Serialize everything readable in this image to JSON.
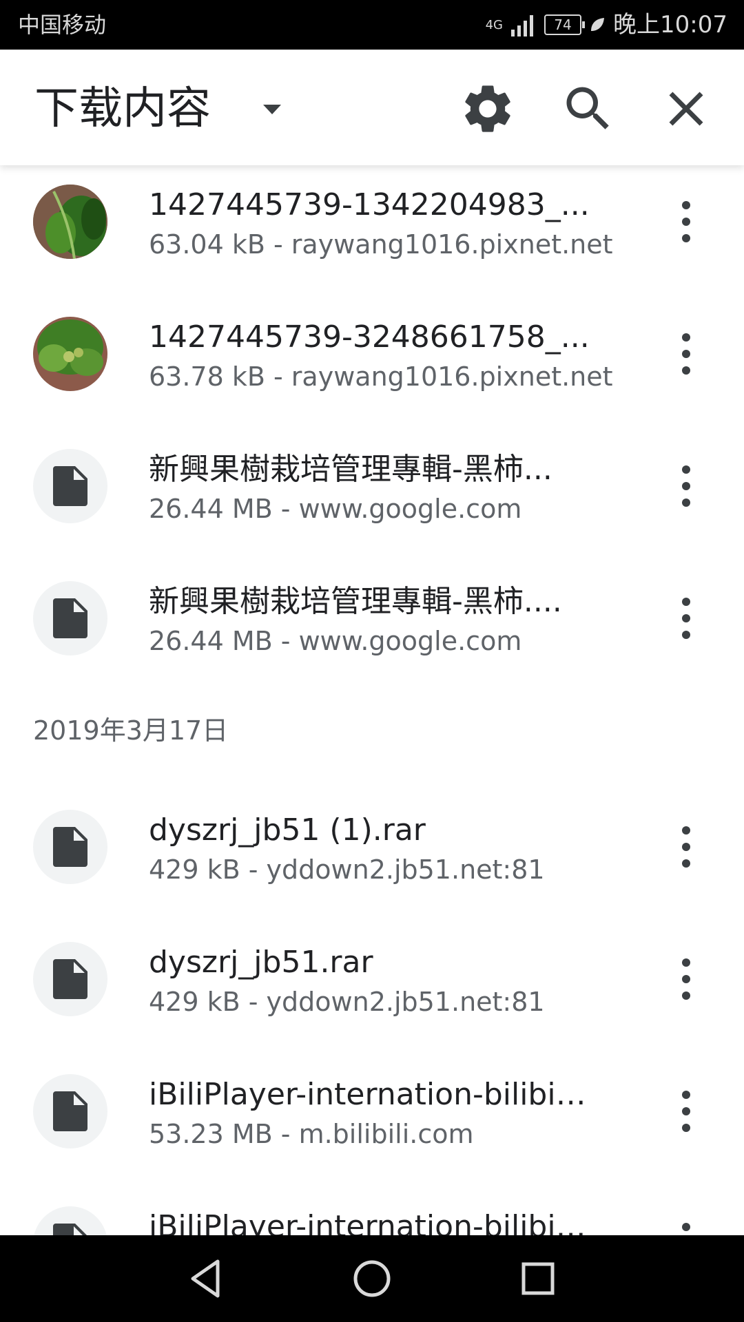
{
  "status_bar": {
    "carrier": "中国移动",
    "network": "4G",
    "battery": "74",
    "time": "晚上10:07"
  },
  "app_bar": {
    "title": "下载内容",
    "icons": [
      "chevron-down-icon",
      "gear-icon",
      "search-icon",
      "close-icon"
    ]
  },
  "downloads": [
    {
      "name": "1427445739-1342204983_...",
      "meta": "63.04 kB - raywang1016.pixnet.net",
      "thumb": "image"
    },
    {
      "name": "1427445739-3248661758_...",
      "meta": "63.78 kB - raywang1016.pixnet.net",
      "thumb": "image"
    },
    {
      "name": "新興果樹栽培管理專輯-黑柿...",
      "meta": "26.44 MB - www.google.com",
      "thumb": "file"
    },
    {
      "name": "新興果樹栽培管理專輯-黑柿....",
      "meta": "26.44 MB - www.google.com",
      "thumb": "file"
    }
  ],
  "section": {
    "date": "2019年3月17日"
  },
  "downloads_0317": [
    {
      "name": "dyszrj_jb51 (1).rar",
      "meta": "429 kB - yddown2.jb51.net:81",
      "thumb": "file"
    },
    {
      "name": "dyszrj_jb51.rar",
      "meta": "429 kB - yddown2.jb51.net:81",
      "thumb": "file"
    },
    {
      "name": "iBiliPlayer-internation-bilibili...",
      "meta": "53.23 MB - m.bilibili.com",
      "thumb": "file"
    },
    {
      "name": "iBiliPlayer-internation-bilibili....",
      "meta": "",
      "thumb": "file"
    }
  ],
  "colors": {
    "primary_text": "#202124",
    "secondary_text": "#5f6368",
    "icon": "#3c4043",
    "thumb_bg": "#f1f3f4"
  }
}
